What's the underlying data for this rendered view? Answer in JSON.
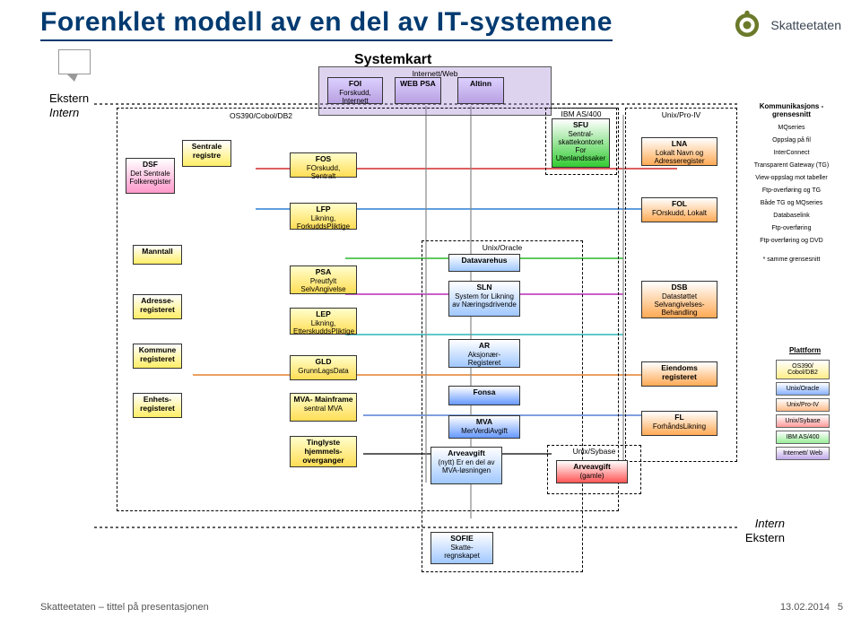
{
  "title": "Forenklet modell av en del av IT-systemene",
  "brand": "Skatteetaten",
  "diagram": {
    "heading": "Systemkart",
    "labels": {
      "ekstern": "Ekstern",
      "intern": "Intern",
      "kom_header": "Kommunikasjons -grensesnitt",
      "platform_header": "Plattform",
      "same": "* samme grensesnitt"
    },
    "frames": {
      "web": {
        "hdr": "Internett/Web",
        "items": {
          "foi": {
            "t": "FOI",
            "s": "Forskudd, Internett"
          },
          "webpsa": {
            "t": "WEB PSA",
            "s": ""
          },
          "altinn": {
            "t": "Altinn",
            "s": ""
          }
        }
      },
      "os390": {
        "hdr": "OS390/Cobol/DB2",
        "items": {
          "dsf": {
            "t": "DSF",
            "s": "Det Sentrale Folkeregister"
          },
          "sentrale": {
            "t": "Sentrale registre",
            "s": ""
          },
          "manntall": {
            "t": "Manntall",
            "s": ""
          },
          "adresse": {
            "t": "Adresse- registeret",
            "s": ""
          },
          "kommune": {
            "t": "Kommune registeret",
            "s": ""
          },
          "enhets": {
            "t": "Enhets- registeret",
            "s": ""
          },
          "fos": {
            "t": "FOS",
            "s": "FOrskudd, Sentralt"
          },
          "lfp": {
            "t": "LFP",
            "s": "Likning, ForkuddsPliktige"
          },
          "psa": {
            "t": "PSA",
            "s": "Preutfylt SelvAngivelse"
          },
          "lep": {
            "t": "LEP",
            "s": "Likning, EtterskuddsPliktige"
          },
          "gld": {
            "t": "GLD",
            "s": "GrunnLagsData"
          },
          "mvamf": {
            "t": "MVA- Mainframe",
            "s": "sentral MVA"
          },
          "ting": {
            "t": "Tinglyste hjemmels- overganger",
            "s": ""
          }
        }
      },
      "as400": {
        "hdr": "IBM AS/400",
        "items": {
          "sfu": {
            "t": "SFU",
            "s": "Sentral- skattekontoret For Utenlandssaker"
          }
        }
      },
      "proiv": {
        "hdr": "Unix/Pro-IV",
        "items": {
          "lna": {
            "t": "LNA",
            "s": "Lokalt Navn og Adresseregister"
          },
          "fol": {
            "t": "FOL",
            "s": "FOrskudd, Lokalt"
          },
          "dsb": {
            "t": "DSB",
            "s": "Datastøttet Selvangivelses- Behandling"
          },
          "eiendom": {
            "t": "Eiendoms registeret",
            "s": ""
          },
          "fl": {
            "t": "FL",
            "s": "ForhåndsLikning"
          }
        }
      },
      "oracle": {
        "hdr": "Unix/Oracle",
        "items": {
          "dvh": {
            "t": "Datavarehus",
            "s": ""
          },
          "sln": {
            "t": "SLN",
            "s": "System for Likning av Næringsdrivende"
          },
          "ar": {
            "t": "AR",
            "s": "Aksjonær- Registeret"
          },
          "fonsa": {
            "t": "Fonsa",
            "s": ""
          },
          "mva": {
            "t": "MVA",
            "s": "MerVerdiAvgift"
          },
          "arve": {
            "t": "Arveavgift",
            "s": "(nytt) Er en del av MVA-løsningen"
          },
          "sofie": {
            "t": "SOFIE",
            "s": "Skatte- regnskapet"
          }
        }
      },
      "sybase": {
        "hdr": "Unix/Sybase",
        "items": {
          "arveg": {
            "t": "Arveavgift",
            "s": "(gamle)"
          }
        }
      }
    },
    "legend": [
      "MQseries",
      "Oppslag på fil",
      "InterConnect",
      "Transparent Gateway (TG)",
      "View-oppslag mot tabeller",
      "Ftp-overføring og TG",
      "Både TG og MQseries",
      "Databaselink",
      "Ftp-overføring",
      "Ftp-overføring og DVD"
    ],
    "platforms": [
      {
        "t": "OS390/ Cobol/DB2",
        "c": "#ffee88"
      },
      {
        "t": "Unix/Oracle",
        "c": "#88b0ff"
      },
      {
        "t": "Unix/Pro-IV",
        "c": "#ffbb88"
      },
      {
        "t": "Unix/Sybase",
        "c": "#ff9999"
      },
      {
        "t": "IBM AS/400",
        "c": "#99ee99"
      },
      {
        "t": "Internett/ Web",
        "c": "#c0a8e8"
      }
    ]
  },
  "footer": {
    "left": "Skatteetaten – tittel på presentasjonen",
    "date": "13.02.2014",
    "page": "5"
  }
}
